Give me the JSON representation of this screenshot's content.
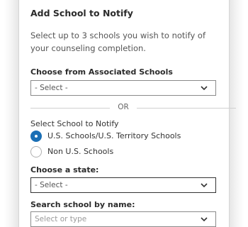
{
  "dialog": {
    "title": "Add School to Notify",
    "description": "Select up to 3 schools you wish to notify of your counseling completion."
  },
  "associated": {
    "label": "Choose from Associated Schools",
    "select_value": "- Select -"
  },
  "divider": {
    "text": "OR"
  },
  "school_type": {
    "label": "Select School to Notify",
    "options": [
      {
        "label": "U.S. Schools/U.S. Territory Schools",
        "checked": true
      },
      {
        "label": "Non U.S. Schools",
        "checked": false
      }
    ]
  },
  "state": {
    "label": "Choose a state:",
    "select_value": "- Select -"
  },
  "search": {
    "label": "Search school by name:",
    "placeholder": "Select or type"
  },
  "colors": {
    "accent": "#1b6fb5",
    "border": "#8a8a8a"
  }
}
